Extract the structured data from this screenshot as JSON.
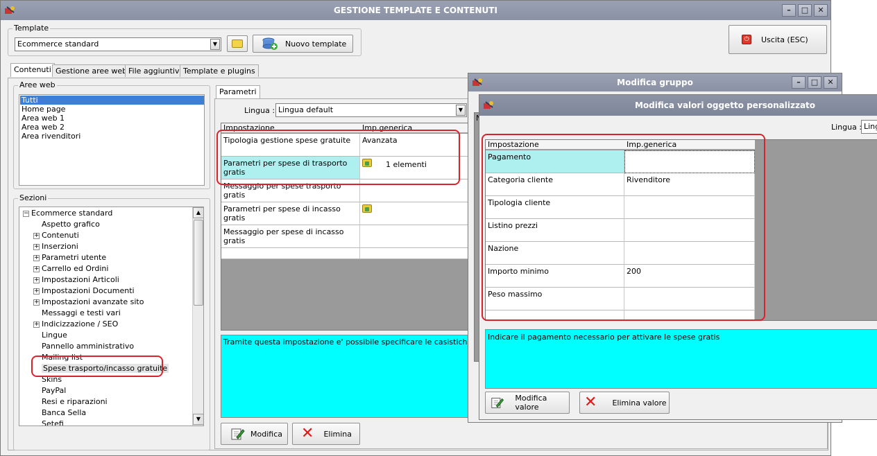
{
  "main": {
    "title": "GESTIONE TEMPLATE E CONTENUTI",
    "template_group_label": "Template",
    "template_value": "Ecommerce standard",
    "new_template_label": "Nuovo template",
    "exit_label": "Uscita (ESC)",
    "tabs": [
      "Contenuti",
      "Gestione aree web",
      "File aggiuntivi",
      "Template e plugins"
    ],
    "aree_web_label": "Aree web",
    "aree_web": [
      "Tutti",
      "Home page",
      "Area web 1",
      "Area web 2",
      "Area rivenditori"
    ],
    "sezioni_label": "Sezioni",
    "tree_root": "Ecommerce standard",
    "tree_items": [
      "Aspetto grafico",
      "Contenuti",
      "Inserzioni",
      "Parametri utente",
      "Carrello ed Ordini",
      "Impostazioni Articoli",
      "Impostazioni Documenti",
      "Impostazioni avanzate sito",
      "Messaggi e testi vari",
      "Indicizzazione / SEO",
      "Lingue",
      "Pannello amministrativo",
      "Mailing list",
      "Spese trasporto/incasso gratuite",
      "Skins",
      "PayPal",
      "Resi e riparazioni",
      "Banca Sella",
      "Setefi"
    ],
    "params_tab": "Parametri",
    "lingua_label": "Lingua :",
    "lingua_value": "Lingua default",
    "grid_header": [
      "Impostazione",
      "Imp.generica"
    ],
    "grid_rows": [
      {
        "name": "Tipologia gestione spese gratuite",
        "value": "Avanzata"
      },
      {
        "name": "Parametri per spese di trasporto gratis",
        "value": "1 elementi"
      },
      {
        "name": "Messaggio per spese trasporto gratis",
        "value": ""
      },
      {
        "name": "Parametri per spese di incasso gratis",
        "value": ""
      },
      {
        "name": "Messaggio per spese di incasso gratis",
        "value": ""
      }
    ],
    "description": "Tramite questa impostazione e' possibile specificare le casistiche per l'attiv",
    "modifica_label": "Modifica",
    "elimina_label": "Elimina"
  },
  "group_window": {
    "title": "Modifica gruppo",
    "grid_hdr_partial": "N"
  },
  "value_window": {
    "title": "Modifica valori oggetto personalizzato",
    "lingua_label": "Lingua :",
    "lingua_value": "Lingu",
    "grid_header": [
      "Impostazione",
      "Imp.generica"
    ],
    "rows": [
      {
        "name": "Pagamento",
        "value": ""
      },
      {
        "name": "Categoria cliente",
        "value": "Rivenditore"
      },
      {
        "name": "Tipologia cliente",
        "value": ""
      },
      {
        "name": "Listino prezzi",
        "value": ""
      },
      {
        "name": "Nazione",
        "value": ""
      },
      {
        "name": "Importo minimo",
        "value": "200"
      },
      {
        "name": "Peso massimo",
        "value": ""
      }
    ],
    "description": "Indicare il pagamento necessario per attivare le spese gratis",
    "modifica_valore_label": "Modifica valore",
    "elimina_valore_label": "Elimina valore"
  },
  "colors": {
    "highlight_cyan": "#00ffff",
    "row_highlight": "#aef0f0",
    "annotation_red": "#d9232b",
    "titlebar": "#8d94a6"
  }
}
